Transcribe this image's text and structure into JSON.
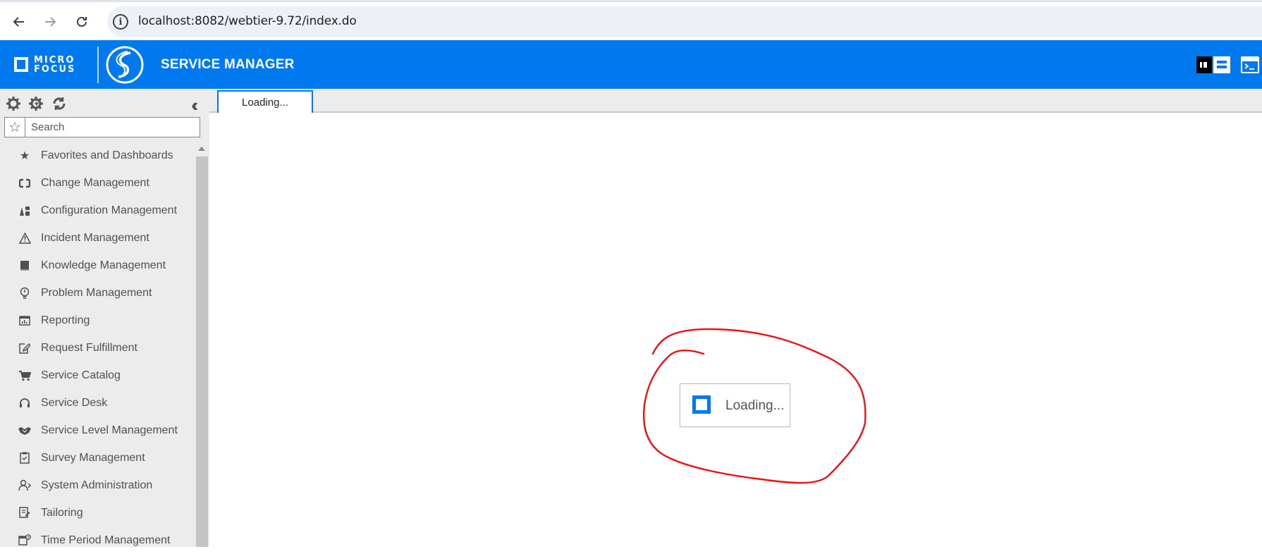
{
  "browser": {
    "url": "localhost:8082/webtier-9.72/index.do",
    "back_icon": "arrow-left-icon",
    "forward_icon": "arrow-right-icon",
    "reload_icon": "reload-icon",
    "info_icon": "info-icon"
  },
  "header": {
    "logo_text_line1": "MICRO",
    "logo_text_line2": "FOCUS",
    "title": "SERVICE MANAGER",
    "brand_color": "#0079ef"
  },
  "sidebar": {
    "search_placeholder": "Search",
    "items": [
      {
        "label": "Favorites and Dashboards",
        "icon": "star-icon"
      },
      {
        "label": "Change Management",
        "icon": "change-icon"
      },
      {
        "label": "Configuration Management",
        "icon": "configuration-icon"
      },
      {
        "label": "Incident Management",
        "icon": "warning-icon"
      },
      {
        "label": "Knowledge Management",
        "icon": "book-icon"
      },
      {
        "label": "Problem Management",
        "icon": "lightbulb-icon"
      },
      {
        "label": "Reporting",
        "icon": "report-icon"
      },
      {
        "label": "Request Fulfillment",
        "icon": "edit-form-icon"
      },
      {
        "label": "Service Catalog",
        "icon": "cart-icon"
      },
      {
        "label": "Service Desk",
        "icon": "headset-icon"
      },
      {
        "label": "Service Level Management",
        "icon": "handshake-icon"
      },
      {
        "label": "Survey Management",
        "icon": "clipboard-check-icon"
      },
      {
        "label": "System Administration",
        "icon": "admin-icon"
      },
      {
        "label": "Tailoring",
        "icon": "tailoring-icon"
      },
      {
        "label": "Time Period Management",
        "icon": "calendar-icon"
      }
    ]
  },
  "tabs": [
    {
      "label": "Loading..."
    }
  ],
  "main": {
    "loading_text": "Loading...",
    "annotation_color": "#ee1111"
  }
}
